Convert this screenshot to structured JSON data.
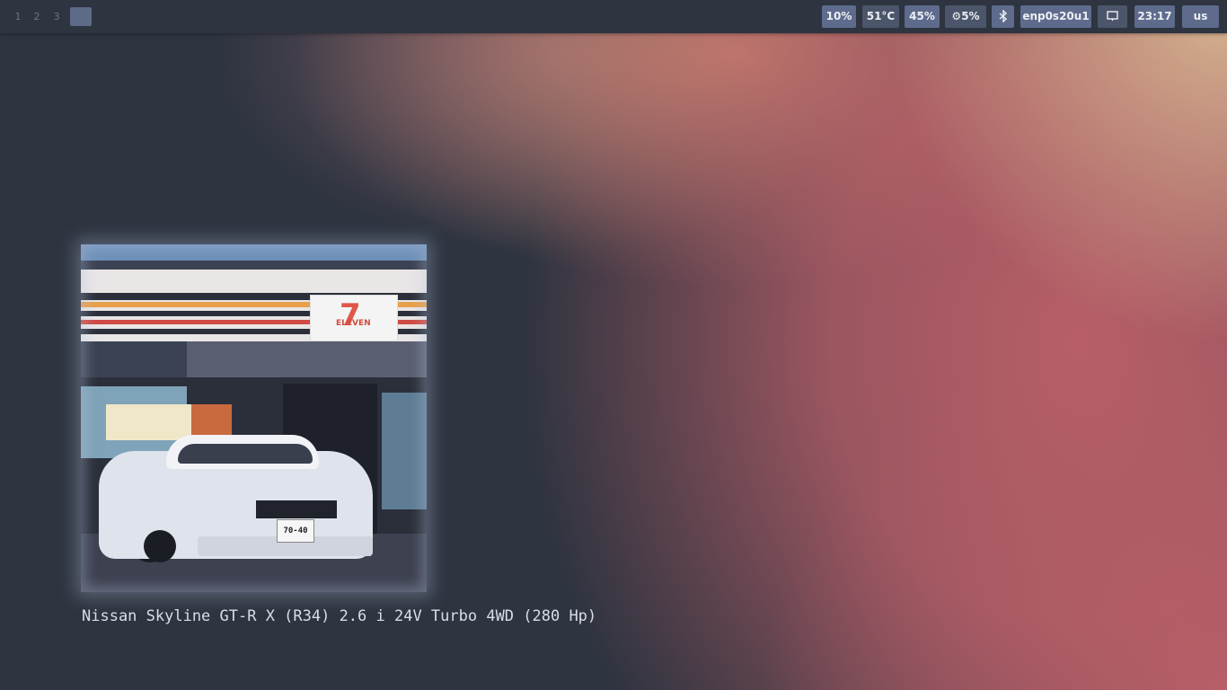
{
  "workspaces": [
    {
      "label": "1"
    },
    {
      "label": "2"
    },
    {
      "label": "3"
    }
  ],
  "status": {
    "cpu": "10%",
    "temperature": "51°C",
    "memory": "45%",
    "backlight_icon": "gear-icon",
    "backlight": "5%",
    "bluetooth_icon": "bluetooth-icon",
    "network": "enp0s20u1",
    "display_icon": "monitor-icon",
    "clock": "23:17",
    "keyboard_layout": "us"
  },
  "photo": {
    "store_logo_number": "7",
    "store_logo_text": "ELEVEN",
    "plate_text": "70-40"
  },
  "caption": "Nissan Skyline GT-R X (R34) 2.6 i 24V Turbo 4WD (280 Hp)",
  "colors": {
    "bar_bg": "#2e3440",
    "chip_bg": "#4c566a",
    "accent": "#bf616a",
    "text": "#d8dee9"
  }
}
